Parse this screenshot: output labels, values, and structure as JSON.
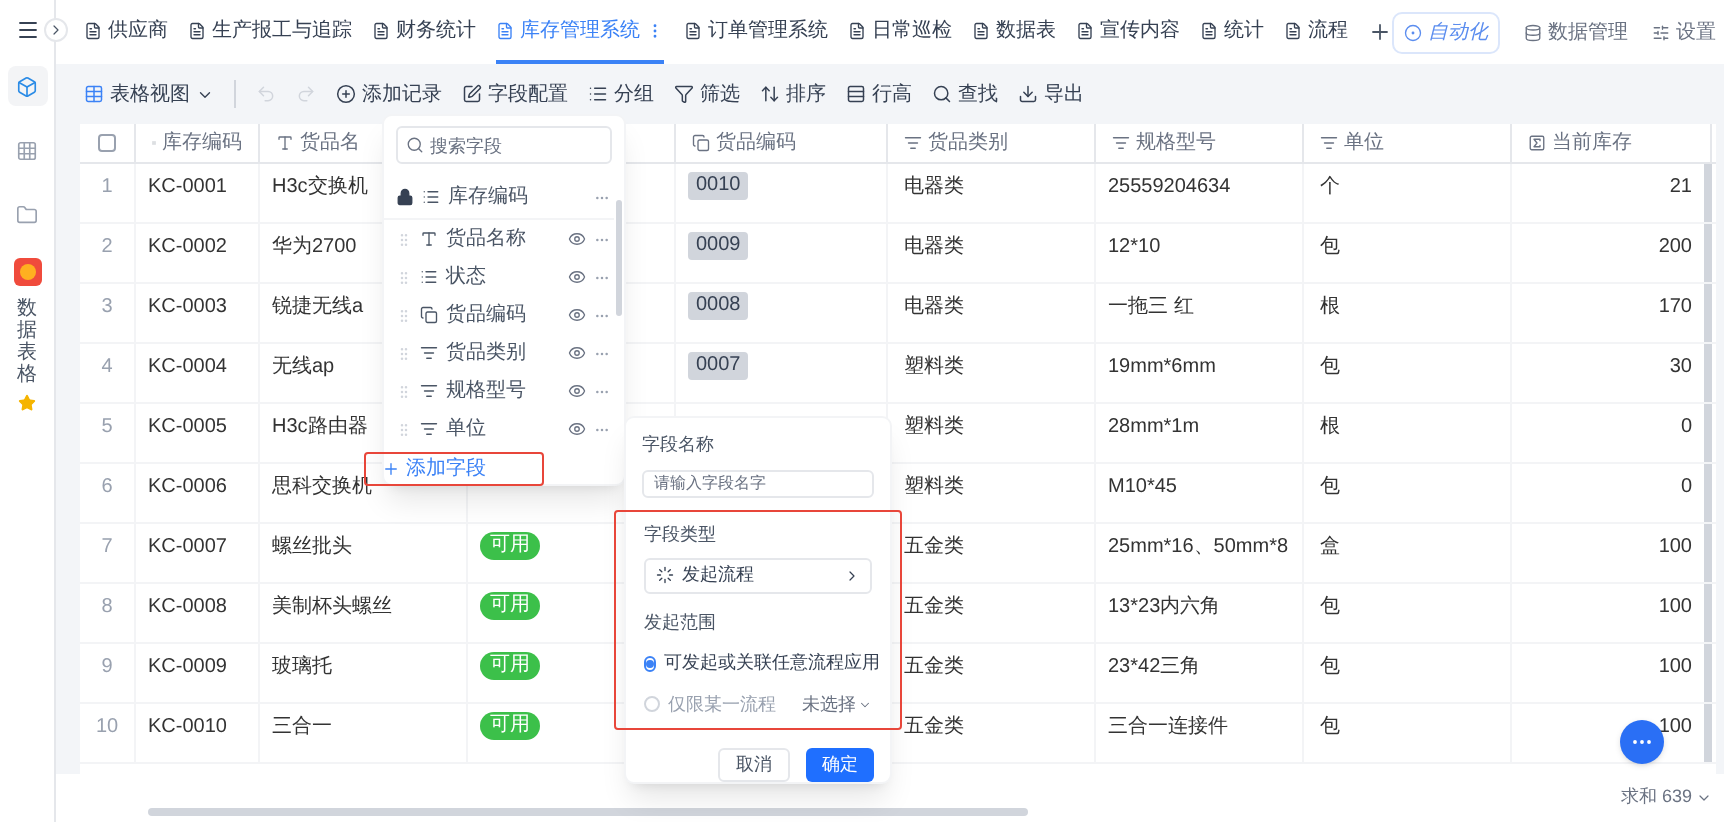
{
  "sidebar": {
    "nav": [
      {
        "kind": "cube",
        "selected": true
      },
      {
        "kind": "grid",
        "selected": false
      },
      {
        "kind": "folder",
        "selected": false
      }
    ],
    "app_label": "数据表格"
  },
  "tabs": [
    {
      "label": "供应商",
      "selected": false
    },
    {
      "label": "生产报工与追踪",
      "selected": false
    },
    {
      "label": "财务统计",
      "selected": false
    },
    {
      "label": "库存管理系统",
      "selected": true
    },
    {
      "label": "订单管理系统",
      "selected": false
    },
    {
      "label": "日常巡检",
      "selected": false
    },
    {
      "label": "数据表",
      "selected": false
    },
    {
      "label": "宣传内容",
      "selected": false
    },
    {
      "label": "统计",
      "selected": false
    },
    {
      "label": "流程",
      "selected": false
    }
  ],
  "top_actions": [
    {
      "label": "自动化",
      "kind": "automation"
    },
    {
      "label": "数据管理",
      "kind": "data"
    },
    {
      "label": "设置",
      "kind": "settings"
    }
  ],
  "toolbar": {
    "view": "表格视图",
    "actions": [
      {
        "label": "添加记录",
        "kind": "add"
      },
      {
        "label": "字段配置",
        "kind": "fields"
      },
      {
        "label": "分组",
        "kind": "group"
      },
      {
        "label": "筛选",
        "kind": "filter"
      },
      {
        "label": "排序",
        "kind": "sort"
      },
      {
        "label": "行高",
        "kind": "height"
      },
      {
        "label": "查找",
        "kind": "search"
      },
      {
        "label": "导出",
        "kind": "export"
      }
    ]
  },
  "table": {
    "select_all": {
      "checked": false
    },
    "columns": [
      {
        "label": "库存编码",
        "kind": "list"
      },
      {
        "label": "货品名",
        "kind": "text"
      },
      {
        "label": "货品编码",
        "kind": "code"
      },
      {
        "label": "货品类别",
        "kind": "select"
      },
      {
        "label": "规格型号",
        "kind": "select"
      },
      {
        "label": "单位",
        "kind": "select"
      },
      {
        "label": "当前库存",
        "kind": "number"
      }
    ],
    "rows": [
      {
        "no": "1",
        "stock_code": "KC-0001",
        "name": "H3c交换机",
        "goods_code": "0010",
        "category": "电器类",
        "spec": "25559204634",
        "unit": "个",
        "stock": "21"
      },
      {
        "no": "2",
        "stock_code": "KC-0002",
        "name": "华为2700",
        "goods_code": "0009",
        "category": "电器类",
        "spec": "12*10",
        "unit": "包",
        "stock": "200"
      },
      {
        "no": "3",
        "stock_code": "KC-0003",
        "name": "锐捷无线a",
        "goods_code": "0008",
        "category": "电器类",
        "spec": "一拖三 红",
        "unit": "根",
        "stock": "170"
      },
      {
        "no": "4",
        "stock_code": "KC-0004",
        "name": "无线ap",
        "goods_code": "0007",
        "category": "塑料类",
        "spec": "19mm*6mm",
        "unit": "包",
        "stock": "30"
      },
      {
        "no": "5",
        "stock_code": "KC-0005",
        "name": "H3c路由器",
        "category": "塑料类",
        "spec": "28mm*1m",
        "unit": "根",
        "stock": "0"
      },
      {
        "no": "6",
        "stock_code": "KC-0006",
        "name": "思科交换机",
        "category": "塑料类",
        "spec": "M10*45",
        "unit": "包",
        "stock": "0"
      },
      {
        "no": "7",
        "stock_code": "KC-0007",
        "name": "螺丝批头",
        "status": "可用",
        "category": "五金类",
        "spec": "25mm*16、50mm*8",
        "unit": "盒",
        "stock": "100"
      },
      {
        "no": "8",
        "stock_code": "KC-0008",
        "name": "美制杯头螺丝",
        "status": "可用",
        "category": "五金类",
        "spec": "13*23内六角",
        "unit": "包",
        "stock": "100"
      },
      {
        "no": "9",
        "stock_code": "KC-0009",
        "name": "玻璃托",
        "status": "可用",
        "category": "五金类",
        "spec": "23*42三角",
        "unit": "包",
        "stock": "100"
      },
      {
        "no": "10",
        "stock_code": "KC-0010",
        "name": "三合一",
        "status": "可用",
        "category": "五金类",
        "spec": "三合一连接件",
        "unit": "包",
        "stock": "100"
      }
    ]
  },
  "field_panel": {
    "search_placeholder": "搜索字段",
    "fields": [
      {
        "label": "库存编码",
        "kind": "list",
        "locked": true
      },
      {
        "label": "货品名称",
        "kind": "text",
        "locked": false
      },
      {
        "label": "状态",
        "kind": "list",
        "locked": false
      },
      {
        "label": "货品编码",
        "kind": "code",
        "locked": false
      },
      {
        "label": "货品类别",
        "kind": "select",
        "locked": false
      },
      {
        "label": "规格型号",
        "kind": "select",
        "locked": false
      },
      {
        "label": "单位",
        "kind": "select",
        "locked": false
      }
    ],
    "add_label": "添加字段"
  },
  "field_editor": {
    "name_label": "字段名称",
    "name_placeholder": "请输入字段名字",
    "type_label": "字段类型",
    "type_value": "发起流程",
    "scope_label": "发起范围",
    "options": [
      {
        "label": "可发起或关联任意流程应用",
        "selected": true
      },
      {
        "label": "仅限某一流程",
        "selected": false,
        "select": "未选择"
      }
    ],
    "buttons": [
      {
        "label": "取消",
        "kind": "secondary"
      },
      {
        "label": "确定",
        "kind": "primary"
      }
    ]
  },
  "footer": {
    "sum": "求和 639"
  }
}
